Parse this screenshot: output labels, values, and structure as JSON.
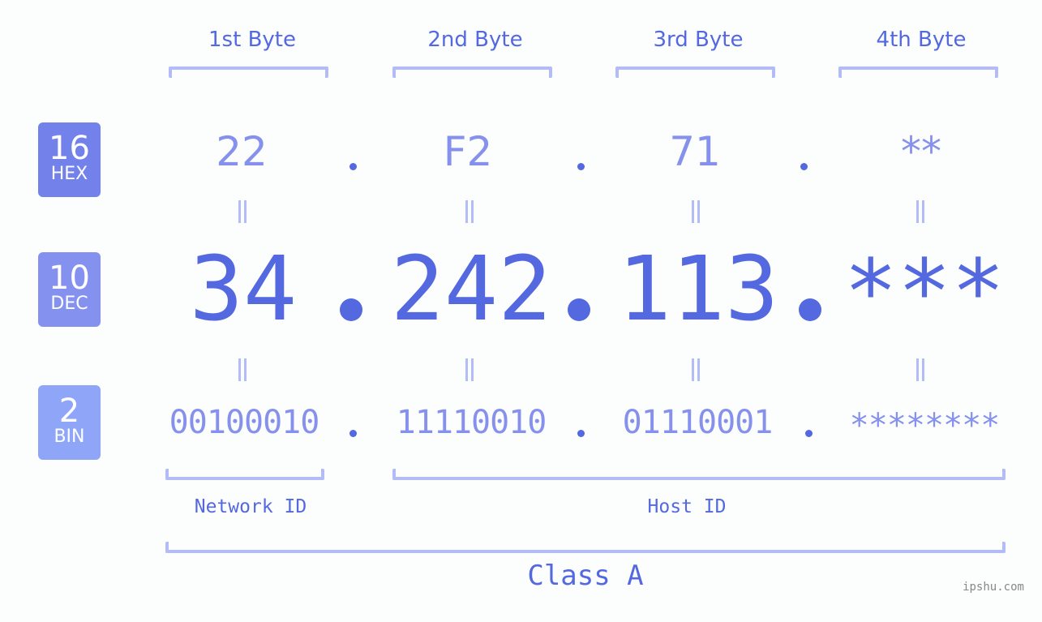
{
  "bytes": [
    {
      "label": "1st Byte",
      "hex": "22",
      "dec": "34",
      "bin": "00100010"
    },
    {
      "label": "2nd Byte",
      "hex": "F2",
      "dec": "242",
      "bin": "11110010"
    },
    {
      "label": "3rd Byte",
      "hex": "71",
      "dec": "113",
      "bin": "01110001"
    },
    {
      "label": "4th Byte",
      "hex": "**",
      "dec": "***",
      "bin": "********"
    }
  ],
  "bases": [
    {
      "number": "16",
      "name": "HEX",
      "color": "#7382eb"
    },
    {
      "number": "10",
      "name": "DEC",
      "color": "#8591ef"
    },
    {
      "number": "2",
      "name": "BIN",
      "color": "#8fa6f8"
    }
  ],
  "segments": {
    "network": "Network ID",
    "host": "Host ID"
  },
  "class_label": "Class A",
  "watermark": "ipshu.com",
  "colors": {
    "accent": "#5468e0",
    "light": "#8591ec",
    "bracket": "#b3bcf6"
  }
}
